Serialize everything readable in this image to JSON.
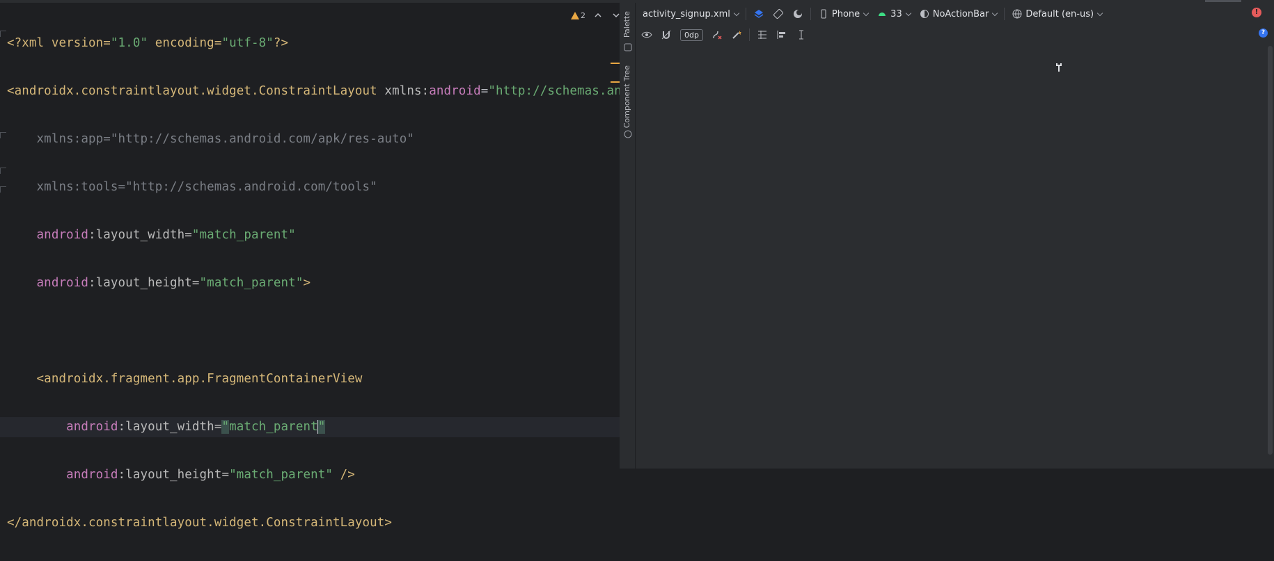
{
  "editor": {
    "lines": [
      {
        "parts": [
          "<?xml version=",
          "\"1.0\"",
          " encoding=",
          "\"utf-8\"",
          "?>"
        ]
      },
      {
        "parts": [
          "<androidx.constraintlayout.widget.ConstraintLayout",
          " xmlns:",
          "android",
          "=",
          "\"http://schemas.androi"
        ]
      },
      {
        "parts": [
          "    xmlns:app=\"http://schemas.android.com/apk/res-auto\""
        ]
      },
      {
        "parts": [
          "    xmlns:tools=\"http://schemas.android.com/tools\""
        ]
      },
      {
        "parts": [
          "    ",
          "android",
          ":layout_width=",
          "\"match_parent\""
        ]
      },
      {
        "parts": [
          "    ",
          "android",
          ":layout_height=",
          "\"match_parent\"",
          ">"
        ]
      },
      {
        "parts": [
          ""
        ]
      },
      {
        "parts": [
          "    ",
          "<androidx.fragment.app.FragmentContainerView"
        ]
      },
      {
        "parts": [
          "        ",
          "android",
          ":layout_width=",
          "\"",
          "match_parent",
          "\""
        ]
      },
      {
        "parts": [
          "        ",
          "android",
          ":layout_height=",
          "\"match_parent\"",
          " />"
        ]
      },
      {
        "parts": [
          "</androidx.constraintlayout.widget.ConstraintLayout>"
        ]
      }
    ],
    "warning_count": "2"
  },
  "side_tools": {
    "palette": "Palette",
    "component_tree": "Component Tree"
  },
  "design_toolbar": {
    "file": "activity_signup.xml",
    "device": "Phone",
    "api": "33",
    "theme": "NoActionBar",
    "locale": "Default (en-us)",
    "margin": "0dp"
  },
  "colors": {
    "tag": "#d5b778",
    "namespace": "#c77dbb",
    "value": "#6aab73",
    "warning": "#e9a743",
    "error": "#e55b5b"
  }
}
